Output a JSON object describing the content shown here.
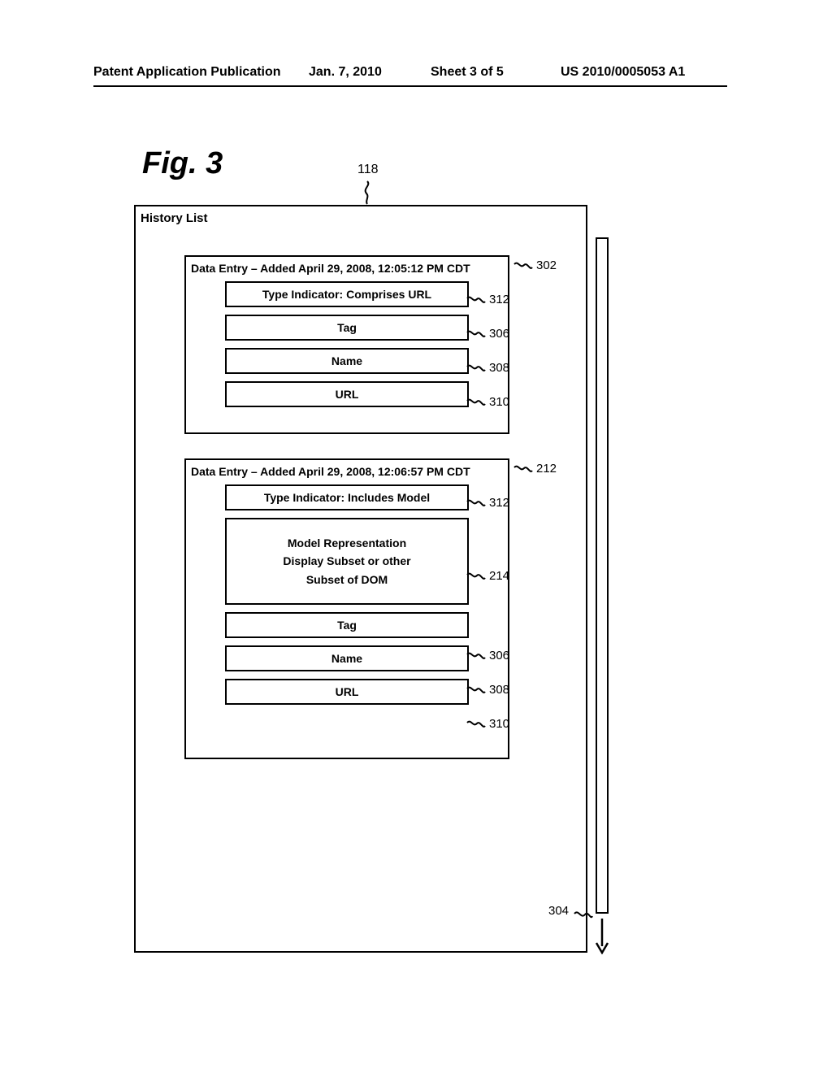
{
  "header": {
    "left": "Patent Application Publication",
    "date": "Jan. 7, 2010",
    "sheet": "Sheet 3 of 5",
    "pubno": "US 2010/0005053 A1"
  },
  "figure_label": "Fig. 3",
  "panel_ref": "118",
  "panel_title": "History List",
  "entry1": {
    "header": "Data Entry – Added April 29, 2008, 12:05:12 PM CDT",
    "type_indicator": "Type Indicator: Comprises URL",
    "tag": "Tag",
    "name": "Name",
    "url": "URL"
  },
  "entry2": {
    "header": "Data Entry – Added April 29, 2008, 12:06:57 PM CDT",
    "type_indicator": "Type Indicator: Includes Model",
    "model_line1": "Model Representation",
    "model_line2": "Display Subset or other",
    "model_line3": "Subset of DOM",
    "tag": "Tag",
    "name": "Name",
    "url": "URL"
  },
  "refs": {
    "r302": "302",
    "r312a": "312",
    "r306a": "306",
    "r308a": "308",
    "r310a": "310",
    "r212": "212",
    "r312b": "312",
    "r214": "214",
    "r306b": "306",
    "r308b": "308",
    "r310b": "310",
    "r304": "304"
  }
}
